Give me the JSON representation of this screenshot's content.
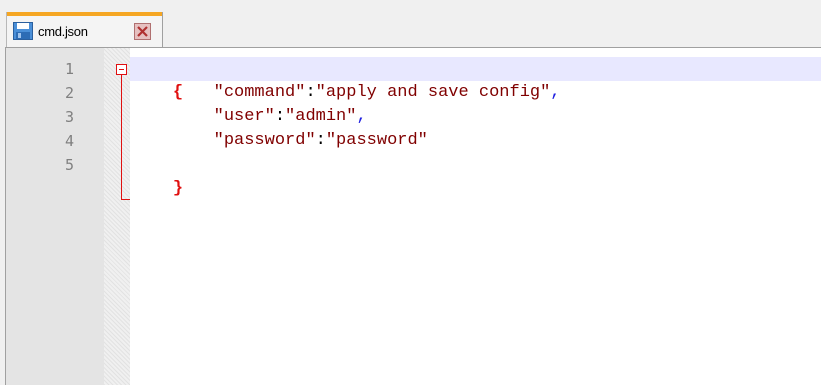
{
  "tabs": [
    {
      "label": "cmd.json",
      "icon": "save-disk-icon",
      "close_icon": "close-icon",
      "accent_color": "#f5a623"
    }
  ],
  "editor": {
    "line_numbers": [
      "1",
      "2",
      "3",
      "4",
      "5"
    ],
    "lines": [
      {
        "brace": "{"
      },
      {
        "indent": "        ",
        "key": "\"command\"",
        "colon": ":",
        "value": "\"apply and save config\"",
        "comma": ","
      },
      {
        "indent": "        ",
        "key": "\"user\"",
        "colon": ":",
        "value": "\"admin\"",
        "comma": ","
      },
      {
        "indent": "        ",
        "key": "\"password\"",
        "colon": ":",
        "value": "\"password\"",
        "comma": ""
      },
      {
        "brace": "}"
      }
    ],
    "colors": {
      "brace": "#e01010",
      "string": "#800000",
      "comma": "#2020e0",
      "current_line": "#e8e8ff"
    }
  }
}
